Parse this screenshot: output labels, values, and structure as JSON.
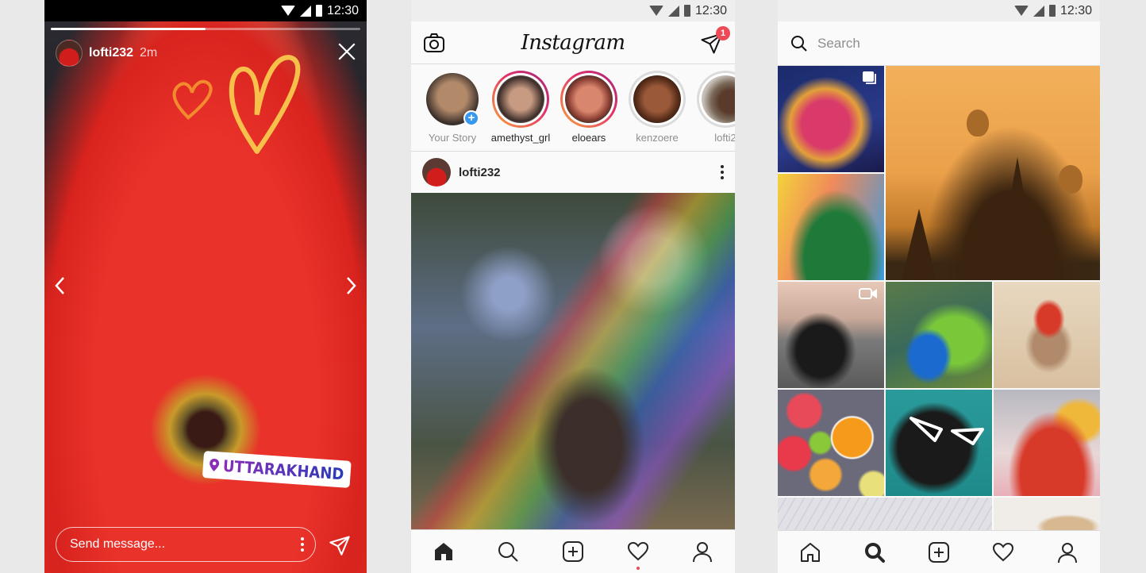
{
  "status_bar": {
    "time": "12:30"
  },
  "story_screen": {
    "username": "lofti232",
    "time_ago": "2m",
    "progress_fraction": 0.5,
    "location_sticker": "UTTARAKHAND",
    "message_placeholder": "Send message...",
    "icons": [
      "close-icon",
      "chevron-left-icon",
      "chevron-right-icon",
      "more-vertical-icon",
      "send-icon",
      "location-pin-icon"
    ]
  },
  "feed_screen": {
    "logo": "Instagram",
    "direct_badge_count": "1",
    "stories": [
      {
        "label": "Your Story",
        "type": "own"
      },
      {
        "label": "amethyst_grl",
        "type": "unseen"
      },
      {
        "label": "eloears",
        "type": "unseen"
      },
      {
        "label": "kenzoere",
        "type": "seen"
      },
      {
        "label": "lofti2",
        "type": "seen"
      }
    ],
    "post": {
      "username": "lofti232"
    },
    "nav": [
      "home",
      "search",
      "add",
      "activity",
      "profile"
    ],
    "active_nav": "home"
  },
  "explore_screen": {
    "search_placeholder": "Search",
    "tiles": [
      {
        "name": "holi-festival",
        "badge": "carousel-icon"
      },
      {
        "name": "temples-balloons",
        "badge": ""
      },
      {
        "name": "concert-singer",
        "badge": ""
      },
      {
        "name": "motorcycle-rider",
        "badge": "video-icon"
      },
      {
        "name": "peacock",
        "badge": ""
      },
      {
        "name": "dancer",
        "badge": ""
      },
      {
        "name": "citrus-fruits",
        "badge": ""
      },
      {
        "name": "sunglasses-portrait",
        "badge": ""
      },
      {
        "name": "spice-market",
        "badge": ""
      },
      {
        "name": "abstract-waves",
        "badge": ""
      },
      {
        "name": "dog",
        "badge": ""
      }
    ],
    "active_nav": "search"
  },
  "colors": {
    "notification_red": "#ed4956",
    "blue_accent": "#3897f0",
    "story_ring_start": "#f9a438",
    "story_ring_end": "#a0287a"
  }
}
